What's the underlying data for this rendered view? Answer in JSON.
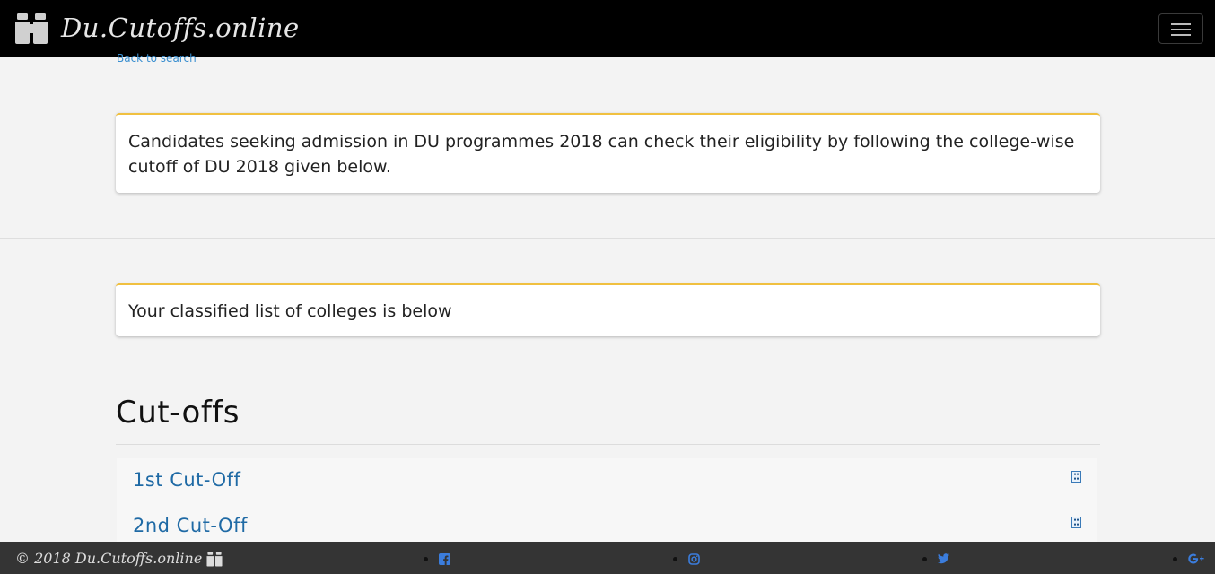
{
  "navbar": {
    "brand": "Du.Cutoffs.online",
    "brand_icon": "binoculars-icon",
    "menu_icon": "hamburger-menu-icon"
  },
  "back_link": "Back to search",
  "intro_card": "Candidates seeking admission in DU programmes 2018 can check their eligibility by following the college-wise cutoff of DU 2018 given below.",
  "list_card": "Your classified list of colleges is below",
  "cutoffs": {
    "title": "Cut-offs",
    "items": [
      {
        "label": "1st Cut-Off",
        "icon": "file-icon"
      },
      {
        "label": "2nd Cut-Off",
        "icon": "file-icon"
      }
    ]
  },
  "footer": {
    "copyright": "© 2018 Du.Cutoffs.online",
    "social": [
      "facebook-icon",
      "instagram-icon",
      "twitter-icon",
      "google-plus-icon"
    ]
  },
  "colors": {
    "navbar_bg": "#000000",
    "footer_bg": "#343434",
    "card_accent": "#f0c040",
    "link": "#1f6aa5"
  }
}
